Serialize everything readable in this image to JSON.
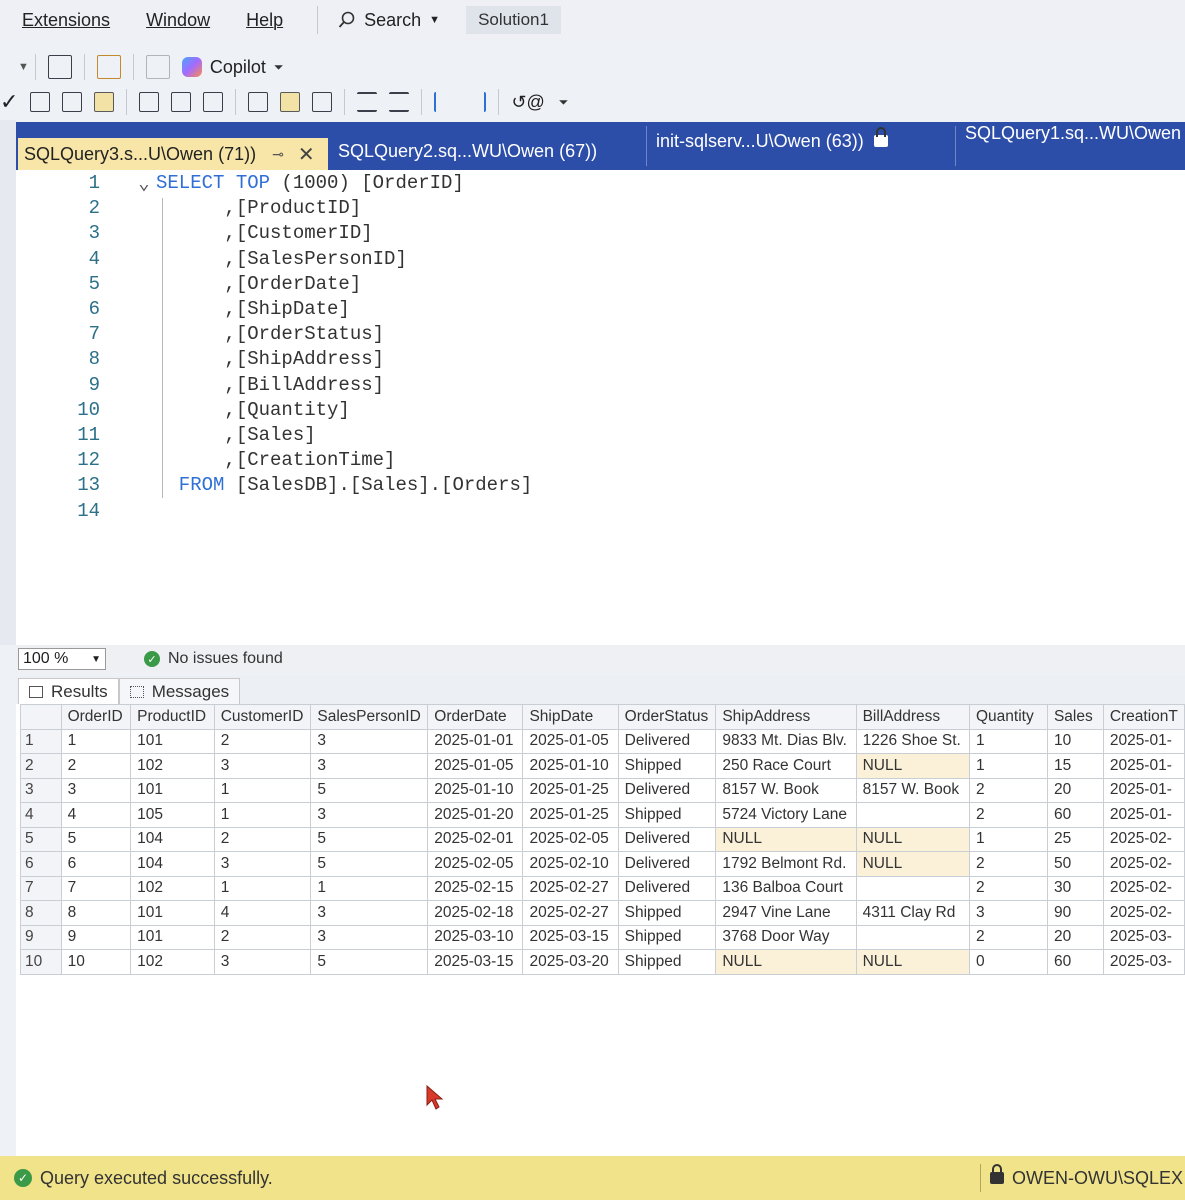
{
  "menu": {
    "items": [
      "Extensions",
      "Window",
      "Help"
    ],
    "search_label": "Search",
    "solution": "Solution1"
  },
  "toolbar": {
    "copilot_label": "Copilot"
  },
  "tabs": [
    {
      "label": "SQLQuery3.s...U\\Owen (71))",
      "active": true
    },
    {
      "label": "SQLQuery2.sq...WU\\Owen (67))",
      "active": false
    },
    {
      "label": "init-sqlserv...U\\Owen (63))",
      "active": false
    },
    {
      "label": "SQLQuery1.sq...WU\\Owen",
      "active": false
    }
  ],
  "editor": {
    "lines": [
      {
        "n": "1",
        "parts": [
          {
            "t": "SELECT TOP",
            "k": true
          },
          {
            "t": " (1000) [OrderID]",
            "k": false
          }
        ]
      },
      {
        "n": "2",
        "parts": [
          {
            "t": "      ,[ProductID]",
            "k": false
          }
        ]
      },
      {
        "n": "3",
        "parts": [
          {
            "t": "      ,[CustomerID]",
            "k": false
          }
        ]
      },
      {
        "n": "4",
        "parts": [
          {
            "t": "      ,[SalesPersonID]",
            "k": false
          }
        ]
      },
      {
        "n": "5",
        "parts": [
          {
            "t": "      ,[OrderDate]",
            "k": false
          }
        ]
      },
      {
        "n": "6",
        "parts": [
          {
            "t": "      ,[ShipDate]",
            "k": false
          }
        ]
      },
      {
        "n": "7",
        "parts": [
          {
            "t": "      ,[OrderStatus]",
            "k": false
          }
        ]
      },
      {
        "n": "8",
        "parts": [
          {
            "t": "      ,[ShipAddress]",
            "k": false
          }
        ]
      },
      {
        "n": "9",
        "parts": [
          {
            "t": "      ,[BillAddress]",
            "k": false
          }
        ]
      },
      {
        "n": "10",
        "parts": [
          {
            "t": "      ,[Quantity]",
            "k": false
          }
        ]
      },
      {
        "n": "11",
        "parts": [
          {
            "t": "      ,[Sales]",
            "k": false
          }
        ]
      },
      {
        "n": "12",
        "parts": [
          {
            "t": "      ,[CreationTime]",
            "k": false
          }
        ]
      },
      {
        "n": "13",
        "parts": [
          {
            "t": "  FROM",
            "k": true
          },
          {
            "t": " [SalesDB].[Sales].[Orders]",
            "k": false
          }
        ]
      },
      {
        "n": "14",
        "parts": []
      }
    ]
  },
  "status_row": {
    "zoom": "100 %",
    "issues": "No issues found"
  },
  "result_tabs": {
    "results": "Results",
    "messages": "Messages"
  },
  "grid": {
    "columns": [
      "OrderID",
      "ProductID",
      "CustomerID",
      "SalesPersonID",
      "OrderDate",
      "ShipDate",
      "OrderStatus",
      "ShipAddress",
      "BillAddress",
      "Quantity",
      "Sales",
      "CreationT"
    ],
    "rows": [
      [
        "1",
        "101",
        "2",
        "3",
        "2025-01-01",
        "2025-01-05",
        "Delivered",
        "9833 Mt. Dias Blv.",
        "1226 Shoe St.",
        "1",
        "10",
        "2025-01-"
      ],
      [
        "2",
        "102",
        "3",
        "3",
        "2025-01-05",
        "2025-01-10",
        "Shipped",
        "250 Race Court",
        "NULL",
        "1",
        "15",
        "2025-01-"
      ],
      [
        "3",
        "101",
        "1",
        "5",
        "2025-01-10",
        "2025-01-25",
        "Delivered",
        "8157 W. Book",
        "8157 W. Book",
        "2",
        "20",
        "2025-01-"
      ],
      [
        "4",
        "105",
        "1",
        "3",
        "2025-01-20",
        "2025-01-25",
        "Shipped",
        "5724 Victory Lane",
        "",
        "2",
        "60",
        "2025-01-"
      ],
      [
        "5",
        "104",
        "2",
        "5",
        "2025-02-01",
        "2025-02-05",
        "Delivered",
        "NULL",
        "NULL",
        "1",
        "25",
        "2025-02-"
      ],
      [
        "6",
        "104",
        "3",
        "5",
        "2025-02-05",
        "2025-02-10",
        "Delivered",
        "1792 Belmont Rd.",
        "NULL",
        "2",
        "50",
        "2025-02-"
      ],
      [
        "7",
        "102",
        "1",
        "1",
        "2025-02-15",
        "2025-02-27",
        "Delivered",
        "136 Balboa Court",
        "",
        "2",
        "30",
        "2025-02-"
      ],
      [
        "8",
        "101",
        "4",
        "3",
        "2025-02-18",
        "2025-02-27",
        "Shipped",
        "2947 Vine Lane",
        "4311 Clay Rd",
        "3",
        "90",
        "2025-02-"
      ],
      [
        "9",
        "101",
        "2",
        "3",
        "2025-03-10",
        "2025-03-15",
        "Shipped",
        "3768 Door Way",
        "",
        "2",
        "20",
        "2025-03-"
      ],
      [
        "10",
        "102",
        "3",
        "5",
        "2025-03-15",
        "2025-03-20",
        "Shipped",
        "NULL",
        "NULL",
        "0",
        "60",
        "2025-03-"
      ]
    ]
  },
  "statusbar": {
    "message": "Query executed successfully.",
    "server": "OWEN-OWU\\SQLEX"
  },
  "colors": {
    "tab_strip": "#2d4ea8",
    "active_tab": "#f7e6a8",
    "keyword": "#2f6fd6",
    "status_bar": "#f0e38a",
    "success": "#3a9a47"
  }
}
